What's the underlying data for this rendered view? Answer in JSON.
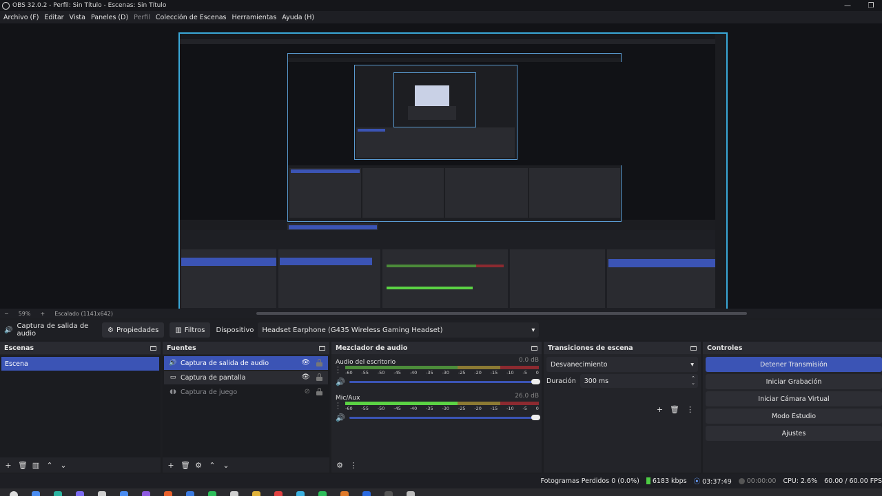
{
  "window": {
    "title": "OBS 32.0.2 - Perfil: Sin Título - Escenas: Sin Título",
    "minimize": "—",
    "maximize": "❐"
  },
  "menu": [
    "Archivo (F)",
    "Editar",
    "Vista",
    "Paneles (D)",
    "Perfil",
    "Colección de Escenas",
    "Herramientas",
    "Ayuda (H)"
  ],
  "preview": {
    "zoom": "59%",
    "scaling": "Escalado (1141x642)"
  },
  "source_toolbar": {
    "source_name": "Captura de salida de audio",
    "properties_label": "Propiedades",
    "filters_label": "Filtros",
    "device_label": "Dispositivo",
    "device_value": "Headset Earphone (G435 Wireless Gaming Headset)"
  },
  "scenes": {
    "title": "Escenas",
    "items": [
      "Escena"
    ]
  },
  "sources": {
    "title": "Fuentes",
    "items": [
      {
        "label": "Captura de salida de audio",
        "icon": "speaker-icon"
      },
      {
        "label": "Captura de pantalla",
        "icon": "monitor-icon"
      },
      {
        "label": "Captura de juego",
        "icon": "gamepad-icon"
      }
    ]
  },
  "mixer": {
    "title": "Mezclador de audio",
    "ticks": [
      "-60",
      "-55",
      "-50",
      "-45",
      "-40",
      "-35",
      "-30",
      "-25",
      "-20",
      "-15",
      "-10",
      "-5",
      "0"
    ],
    "channels": [
      {
        "name": "Audio del escritorio",
        "db": "0.0 dB",
        "level": 0
      },
      {
        "name": "Mic/Aux",
        "db": "26.0 dB",
        "level": 0.78
      }
    ]
  },
  "transitions": {
    "title": "Transiciones de escena",
    "selected": "Desvanecimiento",
    "duration_label": "Duración",
    "duration_value": "300 ms"
  },
  "controls": {
    "title": "Controles",
    "buttons": [
      "Detener Transmisión",
      "Iniciar Grabación",
      "Iniciar Cámara Virtual",
      "Modo Estudio",
      "Ajustes"
    ]
  },
  "status": {
    "dropped": "Fotogramas Perdidos 0 (0.0%)",
    "bitrate": "6183 kbps",
    "stream_time": "03:37:49",
    "rec_time": "00:00:00",
    "cpu": "CPU: 2.6%",
    "fps": "60.00 / 60.00 FPS"
  },
  "colors": {
    "accent": "#3b54b5",
    "preview_border": "#3aa8d8",
    "meter_green": "#5bd344",
    "meter_yellow": "#8c7a33",
    "meter_red": "#8c2a30"
  }
}
